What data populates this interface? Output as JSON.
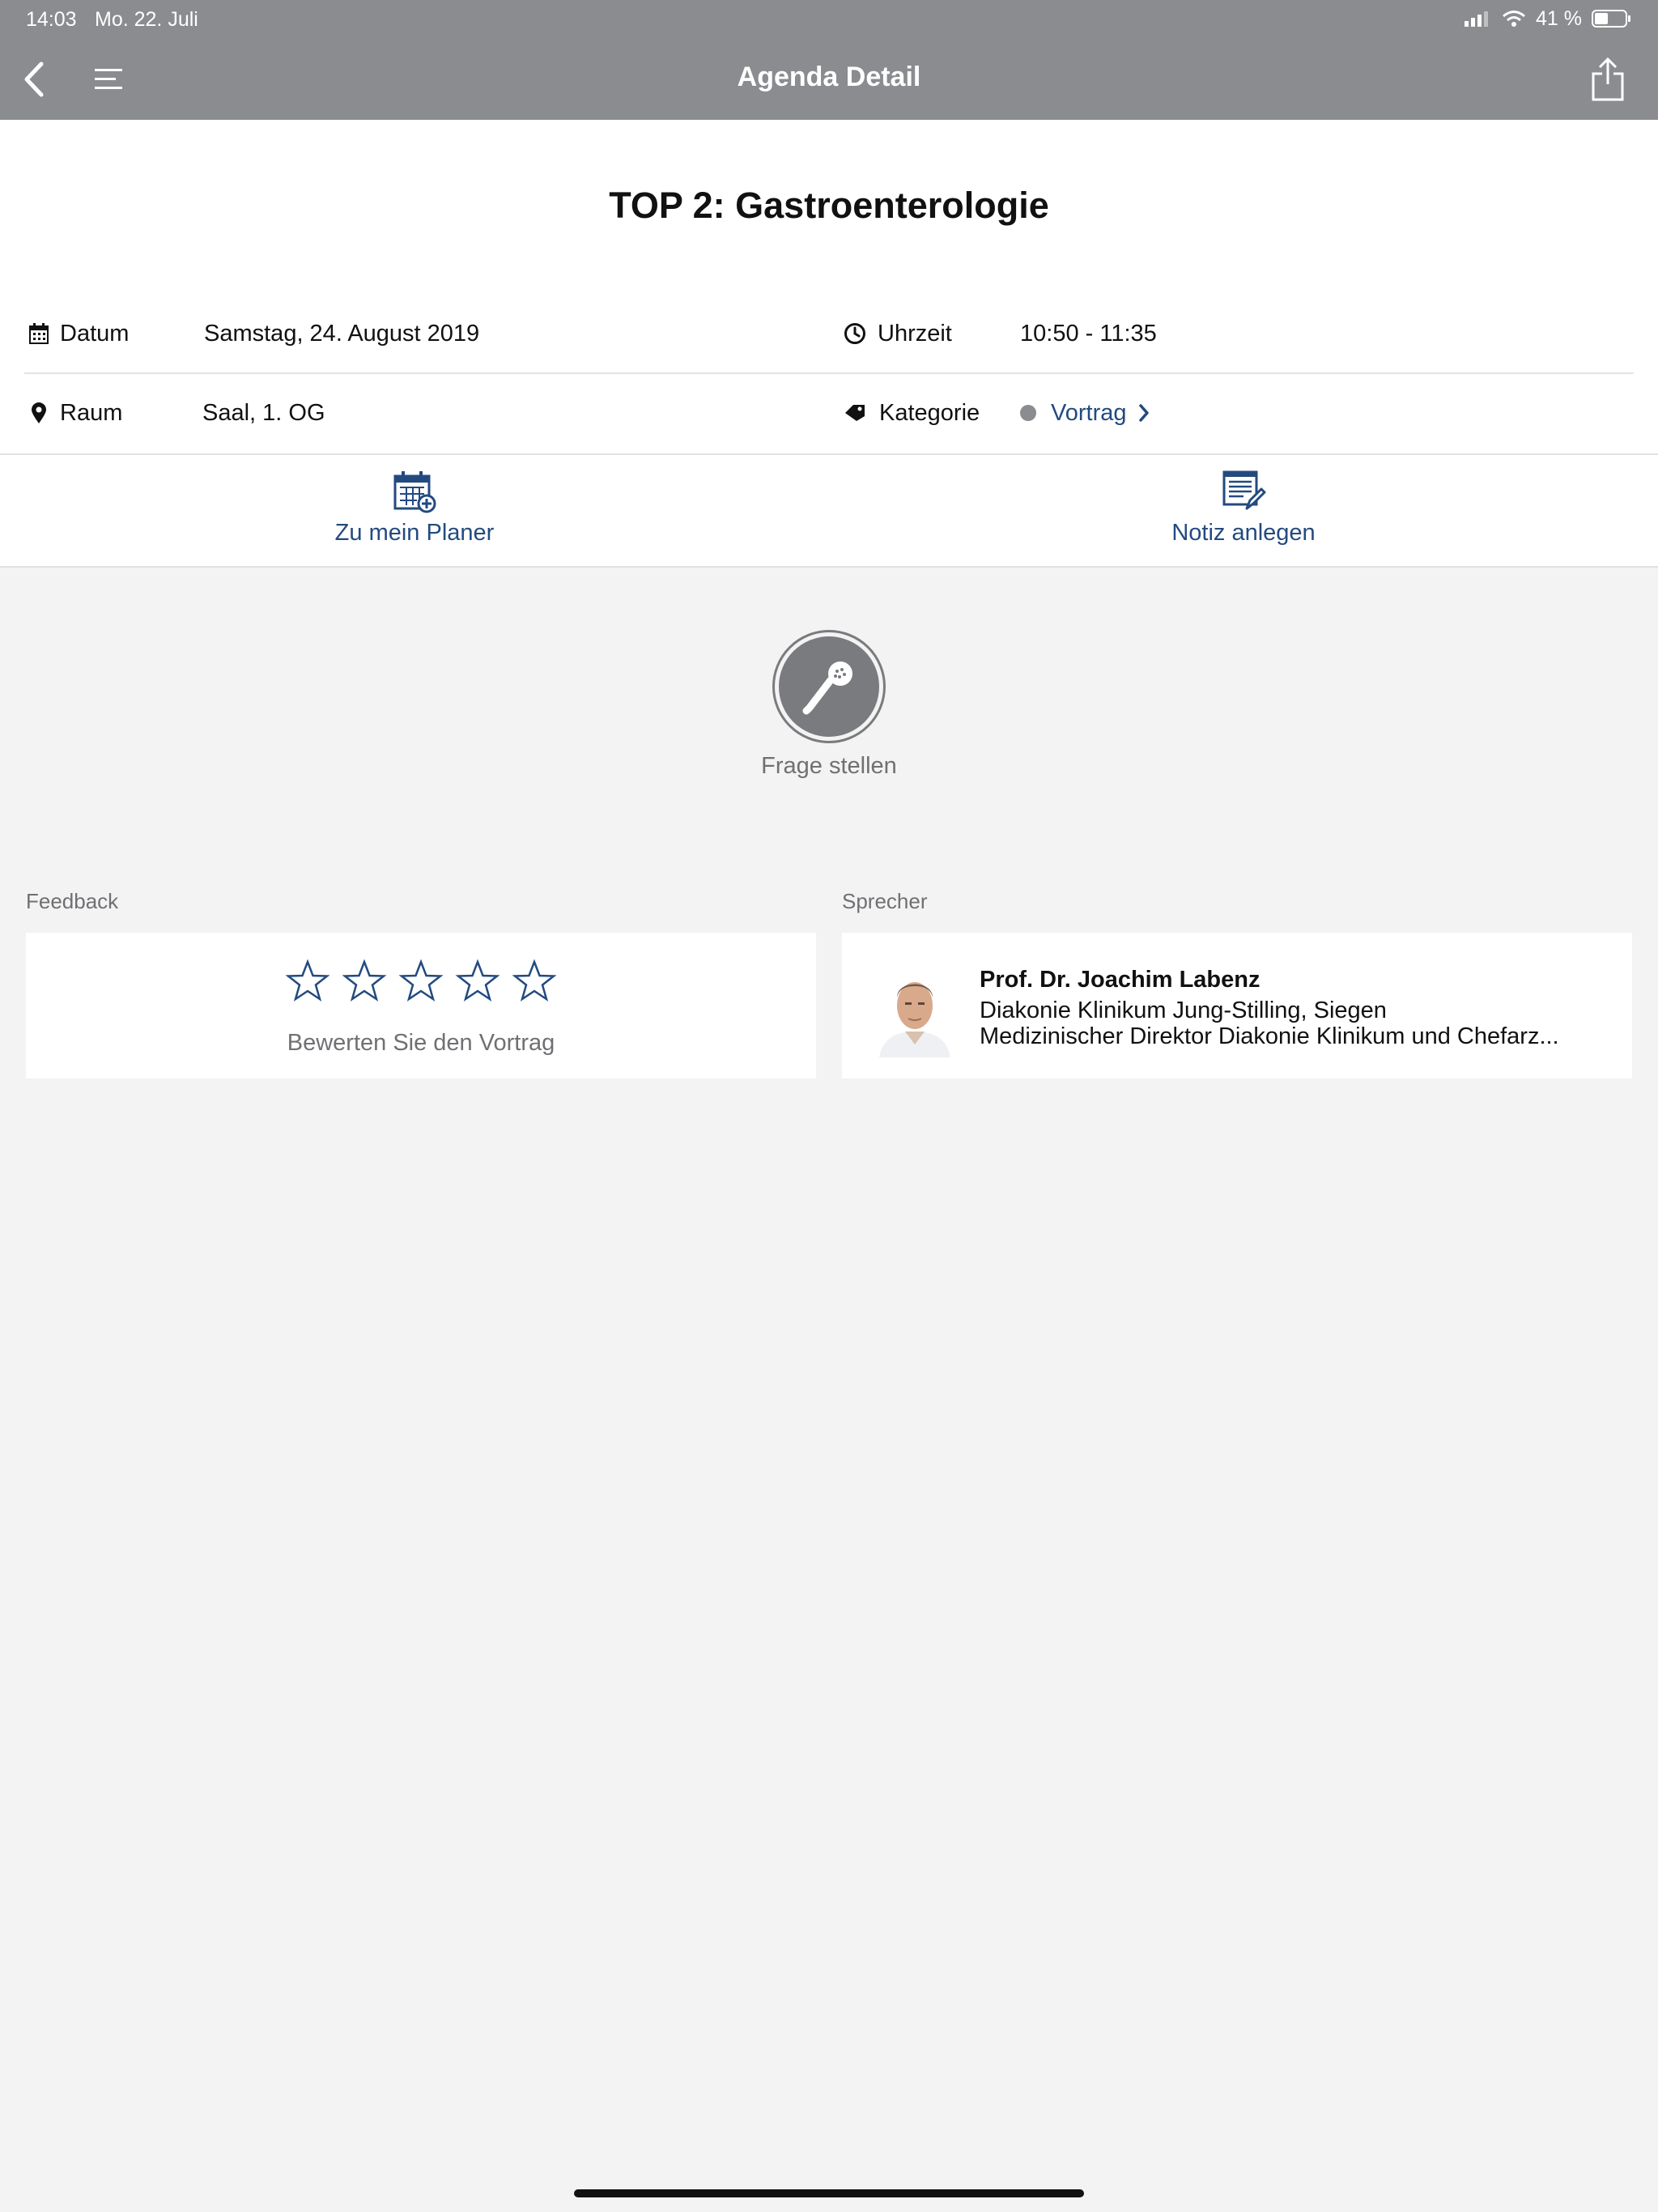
{
  "status_bar": {
    "time": "14:03",
    "date": "Mo. 22. Juli",
    "battery": "41 %"
  },
  "nav": {
    "title": "Agenda Detail",
    "back_icon": "chevron-left-icon",
    "menu_icon": "hamburger-menu-icon",
    "share_icon": "share-icon"
  },
  "session": {
    "title": "TOP 2: Gastroenterologie"
  },
  "info": {
    "date_label": "Datum",
    "date_value": "Samstag, 24. August 2019",
    "time_label": "Uhrzeit",
    "time_value": "10:50 - 11:35",
    "room_label": "Raum",
    "room_value": "Saal, 1. OG",
    "category_label": "Kategorie",
    "category_value": "Vortrag",
    "category_color": "#8a8c8f"
  },
  "actions": {
    "planner_label": "Zu mein Planer",
    "note_label": "Notiz anlegen"
  },
  "question": {
    "label": "Frage stellen"
  },
  "feedback": {
    "section_label": "Feedback",
    "rating": 0,
    "max_rating": 5,
    "prompt": "Bewerten Sie den Vortrag"
  },
  "speaker": {
    "section_label": "Sprecher",
    "name": "Prof. Dr. Joachim Labenz",
    "affiliation": "Diakonie Klinikum Jung-Stilling, Siegen",
    "role": "Medizinischer Direktor Diakonie Klinikum und Chefarz..."
  },
  "colors": {
    "header": "#8a8c8f",
    "accent": "#234a80",
    "background": "#f3f3f3"
  }
}
